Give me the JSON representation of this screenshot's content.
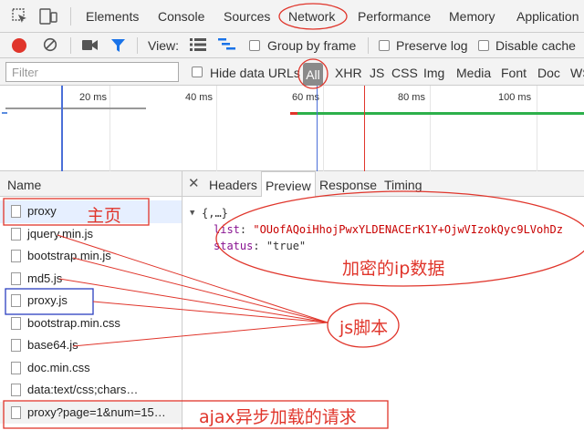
{
  "tabs": [
    "Elements",
    "Console",
    "Sources",
    "Network",
    "Performance",
    "Memory",
    "Application"
  ],
  "active_tab": "Network",
  "toolbar": {
    "view_label": "View:",
    "group_by_frame": "Group by frame",
    "preserve_log": "Preserve log",
    "disable_cache": "Disable cache"
  },
  "filterbar": {
    "placeholder": "Filter",
    "hide_data_urls": "Hide data URLs",
    "types": [
      "All",
      "XHR",
      "JS",
      "CSS",
      "Img",
      "Media",
      "Font",
      "Doc",
      "WS"
    ]
  },
  "overview": {
    "ticks": [
      "20 ms",
      "40 ms",
      "60 ms",
      "80 ms",
      "100 ms"
    ]
  },
  "requests": {
    "header": "Name",
    "items": [
      "proxy",
      "jquery.min.js",
      "bootstrap.min.js",
      "md5.js",
      "proxy.js",
      "bootstrap.min.css",
      "base64.js",
      "doc.min.css",
      "data:text/css;chars…",
      "proxy?page=1&num=15…"
    ]
  },
  "detail": {
    "tabs": [
      "Headers",
      "Preview",
      "Response",
      "Timing"
    ],
    "active": "Preview",
    "root": "{,…}",
    "list_key": "list",
    "list_value": "\"OUofAQoiHhojPwxYLDENACErK1Y+OjwVIzokQyc9LVohDz",
    "status_key": "status",
    "status_value": "\"true\""
  },
  "annotations": {
    "main_page": "主页",
    "encrypted_ip": "加密的ip数据",
    "js_scripts": "js脚本",
    "ajax_requests": "ajax异步加载的请求"
  },
  "colors": {
    "record_red": "#e0352b",
    "filter_blue": "#1a73e8",
    "annotation_red": "#e0352b",
    "annotation_blue": "#2b3fbf",
    "timeline_green": "#2db04b",
    "timeline_blue": "#5b8de0"
  }
}
